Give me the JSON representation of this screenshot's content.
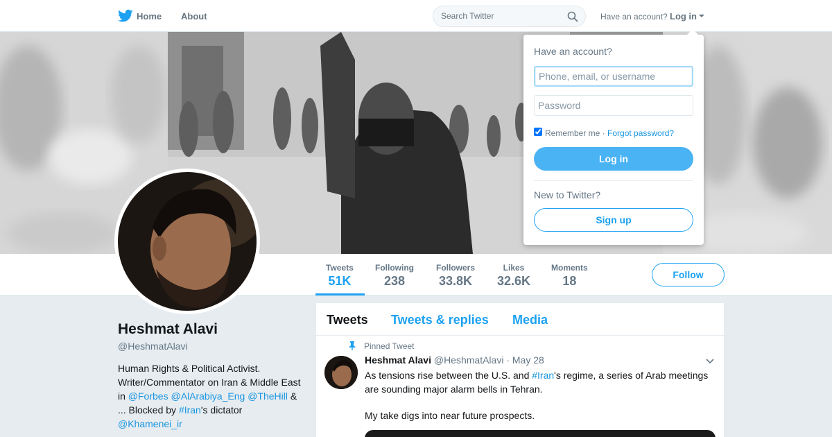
{
  "nav": {
    "home_label": "Home",
    "about_label": "About",
    "search_placeholder": "Search Twitter",
    "have_account": "Have an account?",
    "login_label": "Log in",
    "brand_color": "#1da1f2"
  },
  "profile": {
    "name": "Heshmat Alavi",
    "handle": "@HeshmatAlavi",
    "bio": {
      "line1": "Human Rights & Political Activist. Writer/Commentator on Iran & Middle East in ",
      "forbes": "@Forbes",
      "alarabiya": "@AlArabiya_Eng",
      "thehill": "@TheHill",
      "mid": " & ... Blocked by ",
      "iran": "#Iran",
      "dictator": "'s dictator ",
      "khamenei": "@Khamenei_ir"
    }
  },
  "stats": [
    {
      "label": "Tweets",
      "value": "51K"
    },
    {
      "label": "Following",
      "value": "238"
    },
    {
      "label": "Followers",
      "value": "33.8K"
    },
    {
      "label": "Likes",
      "value": "32.6K"
    },
    {
      "label": "Moments",
      "value": "18"
    }
  ],
  "follow_label": "Follow",
  "timeline": {
    "tabs": [
      "Tweets",
      "Tweets & replies",
      "Media"
    ],
    "pinned_label": "Pinned Tweet",
    "tweet": {
      "name": "Heshmat Alavi",
      "handle": "@HeshmatAlavi",
      "dot": " · ",
      "date": "May 28",
      "text_a": "As tensions rise between the U.S. and ",
      "hashtag": "#Iran",
      "text_b": "'s regime, a series of Arab meetings are sounding major alarm bells in Tehran.",
      "text2": "My take digs into near future prospects."
    }
  },
  "login_dropdown": {
    "title": "Have an account?",
    "username_placeholder": "Phone, email, or username",
    "password_placeholder": "Password",
    "remember_label": "Remember me",
    "separator": " · ",
    "forgot_label": "Forgot password?",
    "login_button": "Log in",
    "new_label": "New to Twitter?",
    "signup_button": "Sign up"
  }
}
